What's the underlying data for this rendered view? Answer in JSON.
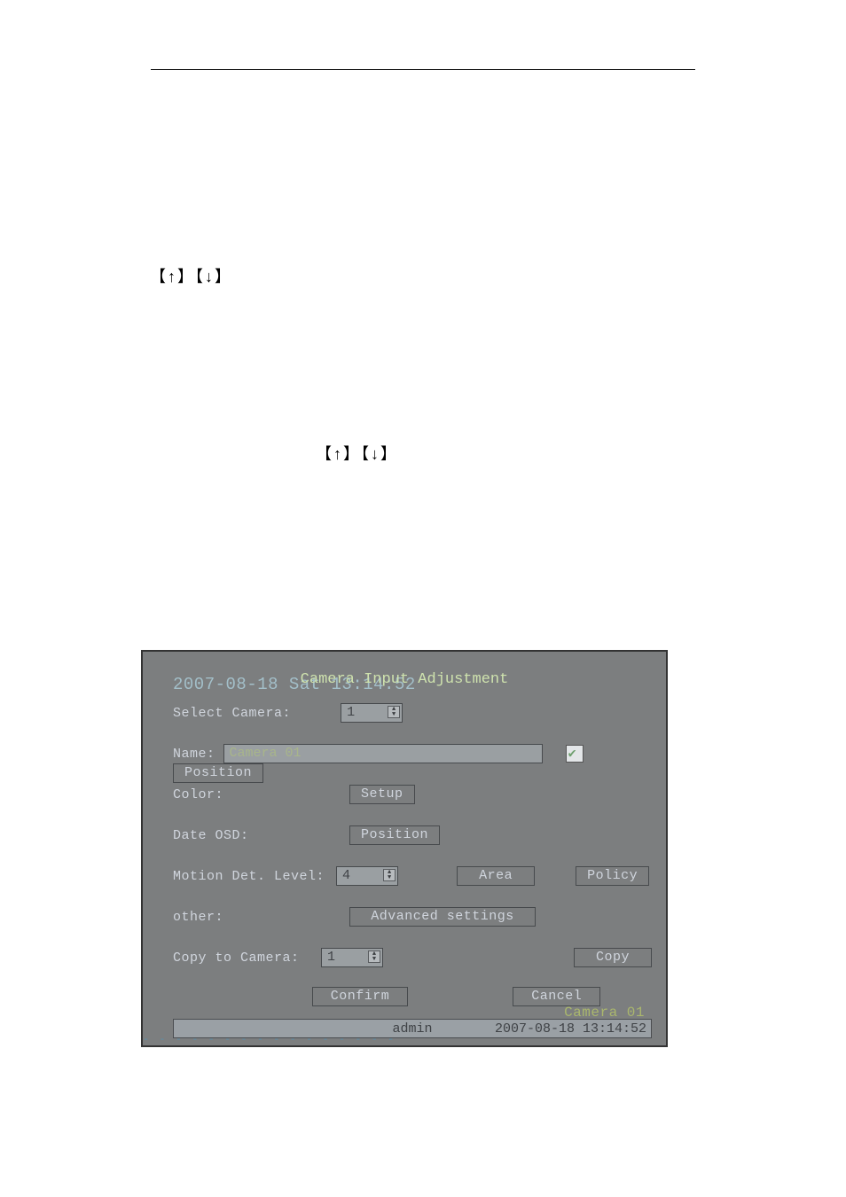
{
  "page": {
    "arrow_text_1": "【↑】【↓】",
    "arrow_text_2": "【↑】【↓】"
  },
  "dvr": {
    "header_bg_text": "2007-08-18 Sat 13:14:52",
    "header_fg_text": "Camera Input Adjustment",
    "select_camera_label": "Select Camera:",
    "select_camera_value": "1",
    "name_label": "Name:",
    "name_value": "Camera 01",
    "position_btn": "Position",
    "color_label": "Color:",
    "setup_btn": "Setup",
    "date_osd_label": "Date OSD:",
    "date_osd_position_btn": "Position",
    "motion_label": "Motion Det. Level:",
    "motion_value": "4",
    "area_btn": "Area",
    "policy_btn": "Policy",
    "other_label": "other:",
    "advanced_btn": "Advanced settings",
    "copy_to_label": "Copy to Camera:",
    "copy_to_value": "1",
    "copy_btn": "Copy",
    "confirm_btn": "Confirm",
    "cancel_btn": "Cancel",
    "status_user": "admin",
    "status_time": "2007-08-18 13:14:52",
    "camera_ghost": "Camera 01",
    "dashes": "- - - - - - - - - - - - - - - -"
  }
}
